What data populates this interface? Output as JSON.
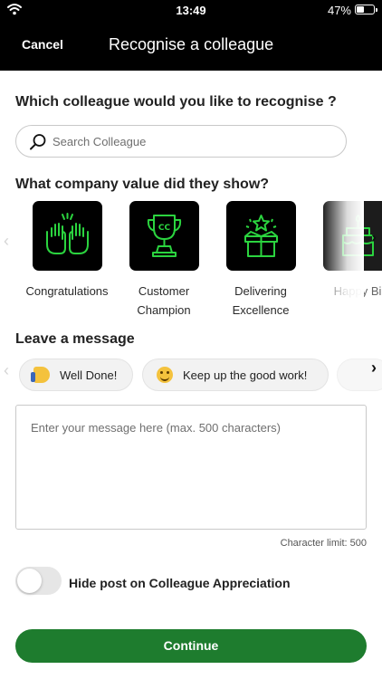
{
  "status_bar": {
    "time": "13:49",
    "battery": "47%",
    "battery_level": 0.47
  },
  "header": {
    "cancel_label": "Cancel",
    "title": "Recognise a colleague"
  },
  "colleague_section": {
    "heading": "Which colleague would you like to recognise ?",
    "search_placeholder": "Search Colleague",
    "search_value": ""
  },
  "values_section": {
    "heading": "What company value did they show?",
    "items": [
      {
        "label_line1": "Congratulations",
        "label_line2": "",
        "icon": "clapping-hands-icon"
      },
      {
        "label_line1": "Customer",
        "label_line2": "Champion",
        "icon": "trophy-icon"
      },
      {
        "label_line1": "Delivering",
        "label_line2": "Excellence",
        "icon": "gift-box-star-icon"
      },
      {
        "label_line1": "Happy Bi",
        "label_line2": "",
        "icon": "birthday-cake-icon"
      }
    ]
  },
  "message_section": {
    "heading": "Leave a message",
    "quick_messages": [
      {
        "label": "Well Done!",
        "icon": "thumbs-up-icon"
      },
      {
        "label": "Keep up the good work!",
        "icon": "grinning-face-icon"
      }
    ],
    "placeholder": "Enter your message here (max. 500 characters)",
    "value": "",
    "char_limit_text": "Character limit: 500"
  },
  "hide_post": {
    "label": "Hide post on Colleague Appreciation",
    "enabled": false
  },
  "continue_label": "Continue",
  "colors": {
    "header_bg": "#000000",
    "icon_green": "#2bd43f",
    "primary_button": "#1e7c2e"
  }
}
